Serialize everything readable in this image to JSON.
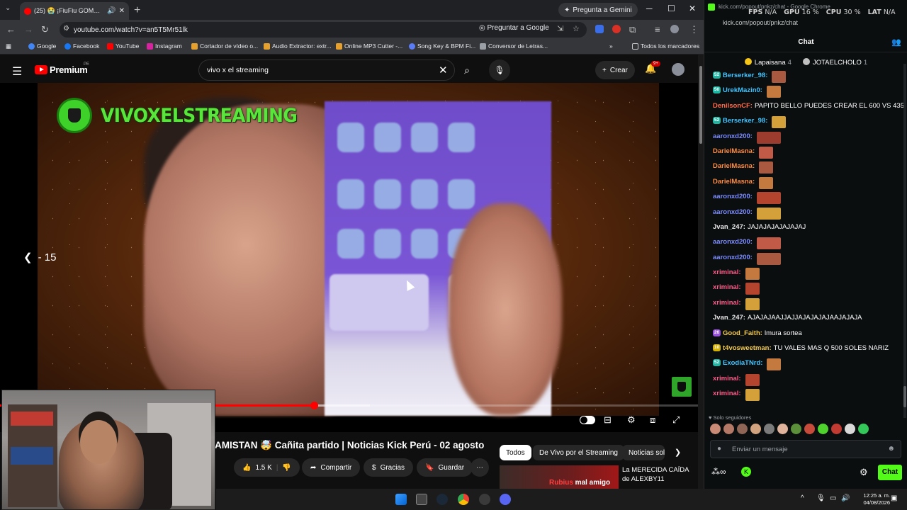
{
  "browser": {
    "tab_title": "(25) 😭 ¡FiuFiu GOMƏARÁ ...",
    "new_tab": "+",
    "gemini_button": "Pregunta a Gemini",
    "url": "youtube.com/watch?v=an5T5Mr51lk",
    "ask_google": "Preguntar a Google",
    "bookmarks": [
      "Google",
      "Facebook",
      "YouTube",
      "Instagram",
      "Cortador de vídeo o...",
      "Audio Extractor: extr...",
      "Online MP3 Cutter -...",
      "Song Key & BPM Fi...",
      "Conversor de Letras..."
    ],
    "all_bookmarks": "Todos los marcadores",
    "accent_color": "#ff0000"
  },
  "youtube": {
    "brand": "Premium",
    "country": "PE",
    "search_value": "vivo x el streaming",
    "create_label": "Crear",
    "notifications": "9+",
    "channel_overlay": "VIVOXELSTREAMING",
    "seek_label": "- 15",
    "progress_fraction": 0.45,
    "buffer_fraction": 0.53,
    "video_title": "AMISTAN 🤯 Cañita partido | Noticias Kick Perú - 02 agosto",
    "likes": "1.5 K",
    "share_label": "Compartir",
    "thanks_label": "Gracias",
    "save_label": "Guardar",
    "chips": [
      "Todos",
      "De Vivo por el Streaming",
      "Noticias sol"
    ],
    "rec_thumb_name": "Rubius",
    "rec_thumb_text": "mal amigo",
    "rec_title": "La MERECIDA CAÍDA de ALEXBY11"
  },
  "chat": {
    "window_title": "kick.com/popout/pnkz/chat - Google Chrome",
    "stats": [
      {
        "label": "FPS",
        "value": "N/A"
      },
      {
        "label": "GPU",
        "value": "16 %"
      },
      {
        "label": "CPU",
        "value": "30 %"
      },
      {
        "label": "LAT",
        "value": "N/A"
      }
    ],
    "url": "kick.com/popout/pnkz/chat",
    "header": "Chat",
    "pinned": [
      {
        "name": "Lapaisana",
        "count": "4",
        "color": "#f5c518"
      },
      {
        "name": "JOTAELCHOLO",
        "count": "1",
        "color": "#c0c0c0"
      }
    ],
    "messages": [
      {
        "badge": "52",
        "badge_color": "#1fb5a3",
        "user": "Berserker_98:",
        "color": "#40c4ff",
        "text": "",
        "emotes": 1
      },
      {
        "badge": "50",
        "badge_color": "#1fb5a3",
        "user": "UrekMazin0:",
        "color": "#40c4ff",
        "text": "",
        "emotes": 1
      },
      {
        "badge": "",
        "badge_color": "",
        "user": "DenilsonCF:",
        "color": "#ff6b4a",
        "text": "PAPITO BELLO PUEDES CREAR EL 600 VS 435",
        "emotes": 0
      },
      {
        "badge": "52",
        "badge_color": "#1fb5a3",
        "user": "Berserker_98:",
        "color": "#40c4ff",
        "text": "",
        "emotes": 1
      },
      {
        "badge": "",
        "badge_color": "",
        "user": "aaronxd200:",
        "color": "#7c8cff",
        "text": "",
        "emotes": 1
      },
      {
        "badge": "",
        "badge_color": "",
        "user": "DarielMasna:",
        "color": "#ff8c42",
        "text": "",
        "emotes": 1
      },
      {
        "badge": "",
        "badge_color": "",
        "user": "DarielMasna:",
        "color": "#ff8c42",
        "text": "",
        "emotes": 1
      },
      {
        "badge": "",
        "badge_color": "",
        "user": "DarielMasna:",
        "color": "#ff8c42",
        "text": "",
        "emotes": 1
      },
      {
        "badge": "",
        "badge_color": "",
        "user": "aaronxd200:",
        "color": "#7c8cff",
        "text": "",
        "emotes": 1
      },
      {
        "badge": "",
        "badge_color": "",
        "user": "aaronxd200:",
        "color": "#7c8cff",
        "text": "",
        "emotes": 1
      },
      {
        "badge": "",
        "badge_color": "",
        "user": "Jvan_247:",
        "color": "#e8e8e8",
        "text": "JAJAJAJAJAJAJAJ",
        "emotes": 0
      },
      {
        "badge": "",
        "badge_color": "",
        "user": "aaronxd200:",
        "color": "#7c8cff",
        "text": "",
        "emotes": 1
      },
      {
        "badge": "",
        "badge_color": "",
        "user": "aaronxd200:",
        "color": "#7c8cff",
        "text": "",
        "emotes": 1
      },
      {
        "badge": "",
        "badge_color": "",
        "user": "xriminal:",
        "color": "#ff5c8a",
        "text": "",
        "emotes": 1
      },
      {
        "badge": "",
        "badge_color": "",
        "user": "xriminal:",
        "color": "#ff5c8a",
        "text": "",
        "emotes": 1
      },
      {
        "badge": "",
        "badge_color": "",
        "user": "xriminal:",
        "color": "#ff5c8a",
        "text": "",
        "emotes": 1
      },
      {
        "badge": "",
        "badge_color": "",
        "user": "Jvan_247:",
        "color": "#e8e8e8",
        "text": "AJAJAJAAJJAJJAJAJAJAJAAJAJAJA",
        "emotes": 0
      },
      {
        "badge": "26",
        "badge_color": "#9b51e0",
        "user": "Good_Faith:",
        "color": "#f2c94c",
        "text": "lmura sortea",
        "emotes": 0
      },
      {
        "badge": "10",
        "badge_color": "#d4b106",
        "user": "t4vosweetman:",
        "color": "#f2c94c",
        "text": "TU VALES MAS Q 500 SOLES NARIZ",
        "emotes": 0
      },
      {
        "badge": "52",
        "badge_color": "#1fb5a3",
        "user": "ExodiaTNrd:",
        "color": "#40c4ff",
        "text": "",
        "emotes": 1
      },
      {
        "badge": "",
        "badge_color": "",
        "user": "xriminal:",
        "color": "#ff5c8a",
        "text": "",
        "emotes": 1
      },
      {
        "badge": "",
        "badge_color": "",
        "user": "xriminal:",
        "color": "#ff5c8a",
        "text": "",
        "emotes": 1
      }
    ],
    "followers_only": "Solo seguidores",
    "input_placeholder": "Enviar un mensaje",
    "chat_button": "Chat",
    "accent_color": "#53fc18"
  },
  "taskbar": {
    "time": "12:25 a. m.",
    "date": "04/08/2026"
  }
}
